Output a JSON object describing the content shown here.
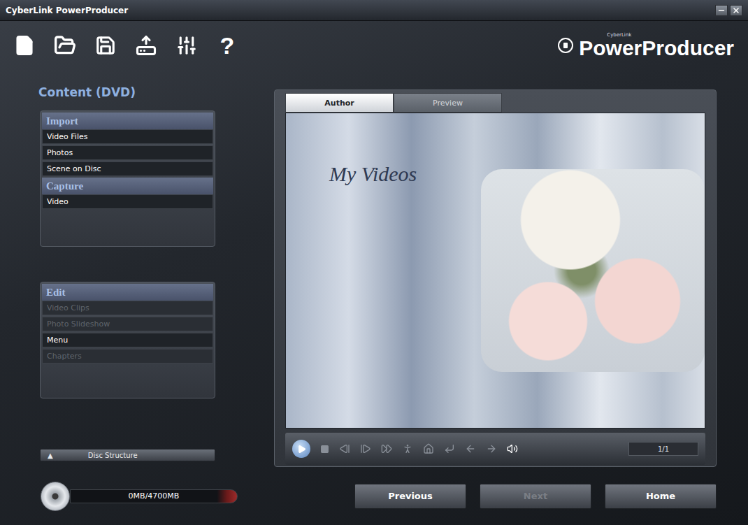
{
  "window": {
    "title": "CyberLink PowerProducer"
  },
  "toolbar": {
    "help": "?",
    "logo": {
      "brand": "CyberLink",
      "name": "PowerProducer"
    }
  },
  "sidebar": {
    "title": "Content (DVD)",
    "groups": [
      {
        "title": "Import",
        "items": [
          {
            "label": "Video Files",
            "disabled": false
          },
          {
            "label": "Photos",
            "disabled": false
          },
          {
            "label": "Scene on Disc",
            "disabled": false
          }
        ]
      },
      {
        "title": "Capture",
        "items": [
          {
            "label": "Video",
            "disabled": false
          }
        ]
      }
    ],
    "edit": {
      "title": "Edit",
      "items": [
        {
          "label": "Video Clips",
          "disabled": true
        },
        {
          "label": "Photo Slideshow",
          "disabled": true
        },
        {
          "label": "Menu",
          "disabled": false
        },
        {
          "label": "Chapters",
          "disabled": true
        }
      ]
    },
    "disc_structure": {
      "arrow": "▲",
      "label": "Disc Structure"
    }
  },
  "tabs": [
    {
      "label": "Author",
      "selected": true
    },
    {
      "label": "Preview",
      "selected": false
    }
  ],
  "preview": {
    "menu_title": "My Videos",
    "page": "1/1"
  },
  "disc": {
    "usage": "0MB/4700MB",
    "level": 0
  },
  "buttons": [
    {
      "label": "Previous",
      "disabled": false
    },
    {
      "label": "Next",
      "disabled": true
    },
    {
      "label": "Home",
      "disabled": false
    }
  ]
}
